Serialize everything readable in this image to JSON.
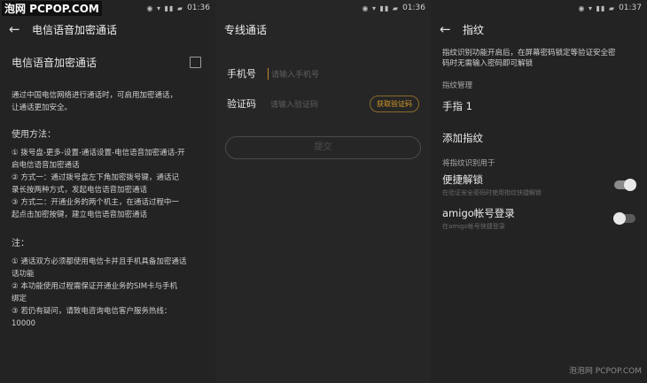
{
  "watermark": {
    "top": "泡网 PCPOP.COM",
    "bottom": "泡泡网 PCPOP.COM"
  },
  "screen1": {
    "status": {
      "time": "01:36"
    },
    "title": "电信语音加密通话",
    "option_label": "电信语音加密通话",
    "intro": [
      "通过中国电信网络进行通话时，可启用加密通话，",
      "让通话更加安全。"
    ],
    "usage_heading": "使用方法：",
    "usage_lines": [
      "① 拨号盘-更多-设置-通话设置-电信语音加密通话-开",
      "启电信语音加密通话",
      "② 方式一：通过拨号盘左下角加密拨号键，通话记",
      "录长按两种方式，发起电信语音加密通话",
      "③ 方式二：开通业务的两个机主，在通话过程中一",
      "起点击加密按键，建立电信语音加密通话"
    ],
    "note_heading": "注：",
    "note_lines": [
      "① 通话双方必须都使用电信卡并且手机具备加密通话",
      "话功能",
      "② 本功能使用过程需保证开通业务的SIM卡与手机",
      "绑定",
      "③ 若仍有疑问，请致电咨询电信客户服务热线：",
      "10000"
    ]
  },
  "screen2": {
    "status": {
      "time": "01:36"
    },
    "title": "专线通话",
    "phone_label": "手机号",
    "phone_placeholder": "请输入手机号",
    "code_label": "验证码",
    "code_placeholder": "请输入验证码",
    "code_button": "获取验证码",
    "submit_label": "提交"
  },
  "screen3": {
    "status": {
      "time": "01:37"
    },
    "title": "指纹",
    "description": [
      "指纹识别功能开启后，在屏幕密码锁定等验证安全密",
      "码时无需输入密码即可解锁"
    ],
    "manage_heading": "指纹管理",
    "finger1": "手指 1",
    "add_finger": "添加指纹",
    "use_heading": "将指纹识别用于",
    "unlock": {
      "label": "便捷解锁",
      "sub": "在验证安全密码时使用指纹快捷解锁",
      "state": "on"
    },
    "amigo": {
      "label": "amigo帐号登录",
      "sub": "在amigo帐号快捷登录",
      "state": "off"
    }
  }
}
